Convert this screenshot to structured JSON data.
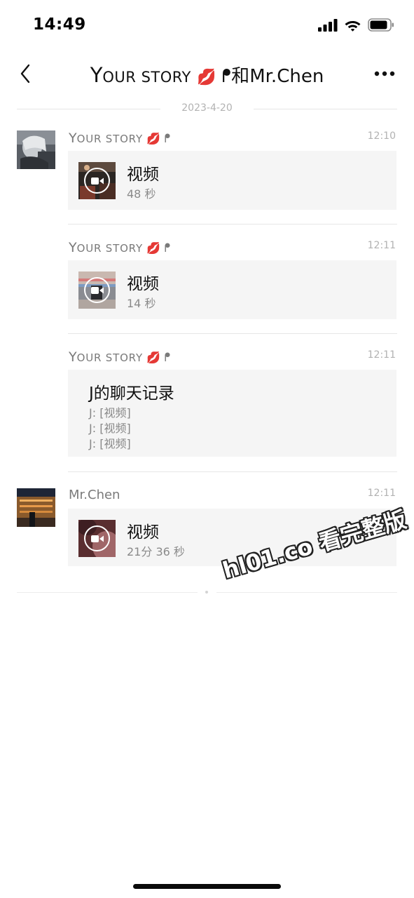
{
  "status": {
    "time": "14:49"
  },
  "nav": {
    "title_first": "Y",
    "title_rest": "OUR STORY",
    "title_emoji": "💋",
    "title_hand": "ᖰ",
    "title_and": "和",
    "title_name": "Mr.Chen",
    "back_icon": "chevron-left-icon",
    "more_icon": "more-dots-icon"
  },
  "date_divider": "2023-4-20",
  "messages": [
    {
      "sender_first": "Y",
      "sender_rest": "OUR STORY",
      "sender_emoji": "💋",
      "sender_hand": "ᖰ",
      "time": "12:10",
      "card_title": "视频",
      "card_sub": "48 秒"
    },
    {
      "sender_first": "Y",
      "sender_rest": "OUR STORY",
      "sender_emoji": "💋",
      "sender_hand": "ᖰ",
      "time": "12:11",
      "card_title": "视频",
      "card_sub": "14 秒"
    },
    {
      "sender_first": "Y",
      "sender_rest": "OUR STORY",
      "sender_emoji": "💋",
      "sender_hand": "ᖰ",
      "time": "12:11",
      "record_title": "J的聊天记录",
      "record_lines": [
        "J: [视频]",
        "J: [视频]",
        "J: [视频]"
      ]
    },
    {
      "sender": "Mr.Chen",
      "time": "12:11",
      "card_title": "视频",
      "card_sub": "21分 36 秒"
    }
  ],
  "watermark": "hl01.co 看完整版",
  "colors": {
    "background": "#ffffff",
    "card": "#f5f5f5",
    "secondary_text": "#7a7a7a",
    "time_text": "#b2b2b2"
  }
}
